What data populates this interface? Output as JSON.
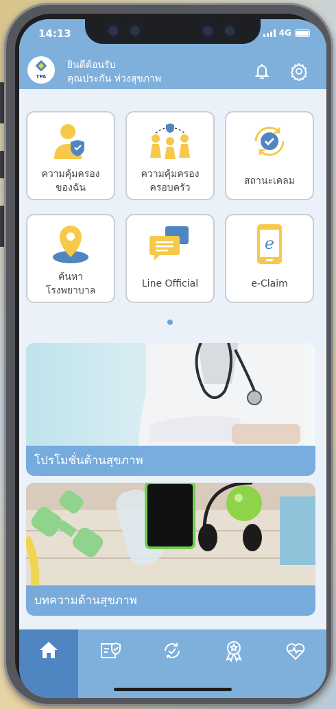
{
  "status": {
    "time": "14:13",
    "network": "4G"
  },
  "header": {
    "logo_text": "TPA",
    "greeting": "ยินดีต้อนรับ",
    "user_name": "คุณประกัน ห่วงสุขภาพ",
    "bell_icon": "bell-icon",
    "settings_icon": "gear-icon"
  },
  "menu": {
    "items": [
      {
        "label": "ความคุ้มครอง\nของฉัน",
        "icon": "user-shield-icon"
      },
      {
        "label": "ความคุ้มครอง\nครอบครัว",
        "icon": "family-shield-icon"
      },
      {
        "label": "สถานะเคลม",
        "icon": "claim-status-icon"
      },
      {
        "label": "ค้นหา\nโรงพยาบาล",
        "icon": "location-pin-icon"
      },
      {
        "label": "Line Official",
        "icon": "chat-bubbles-icon"
      },
      {
        "label": "e-Claim",
        "icon": "mobile-e-icon"
      }
    ],
    "page_indicator": {
      "count": 1,
      "active": 0
    }
  },
  "banners": [
    {
      "title": "โปรโมชั่นด้านสุขภาพ",
      "image": "doctor-with-stethoscope"
    },
    {
      "title": "บทความด้านสุขภาพ",
      "image": "fitness-equipment"
    }
  ],
  "bottom_nav": [
    {
      "icon": "home-icon",
      "active": true
    },
    {
      "icon": "policy-card-icon",
      "active": false
    },
    {
      "icon": "check-circle-icon",
      "active": false
    },
    {
      "icon": "award-badge-icon",
      "active": false
    },
    {
      "icon": "heart-pulse-icon",
      "active": false
    }
  ],
  "colors": {
    "accent": "#7fb0dc",
    "accent_dark": "#4f86c2",
    "icon_yellow": "#f6c94a",
    "icon_blue": "#4f86c2"
  }
}
